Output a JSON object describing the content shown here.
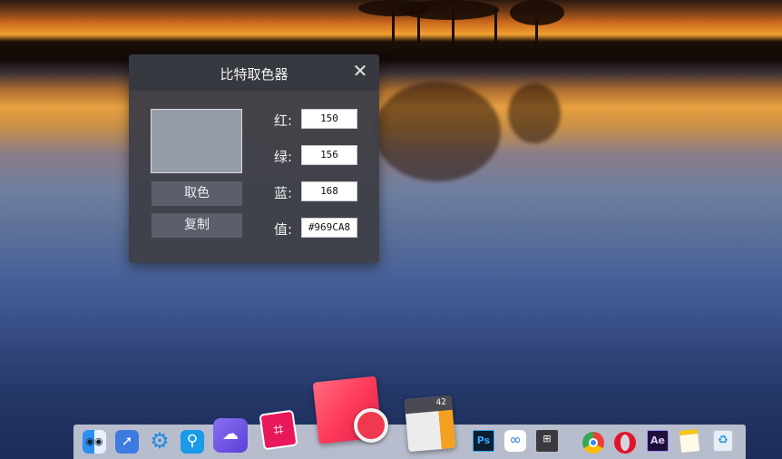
{
  "dialog": {
    "title": "比特取色器",
    "close_glyph": "✕",
    "swatch_color": "#969CA8",
    "pick_button": "取色",
    "copy_button": "复制",
    "red_label": "红:",
    "green_label": "绿:",
    "blue_label": "蓝:",
    "value_label": "值:",
    "red_value": "150",
    "green_value": "156",
    "blue_value": "168",
    "hex_value": "#969CA8"
  },
  "dock": {
    "calculator_display": "42",
    "photoshop_label": "Ps",
    "aftereffects_label": "Ae",
    "icons": [
      "finder-icon",
      "launchpad-icon",
      "settings-icon",
      "search-icon",
      "cloud-icon",
      "crop-icon",
      "color-picker-icon",
      "calculator-icon",
      "photoshop-icon",
      "baidu-netdisk-icon",
      "windows-icon",
      "chrome-icon",
      "opera-icon",
      "aftereffects-icon",
      "notes-icon",
      "recycle-bin-icon"
    ]
  }
}
